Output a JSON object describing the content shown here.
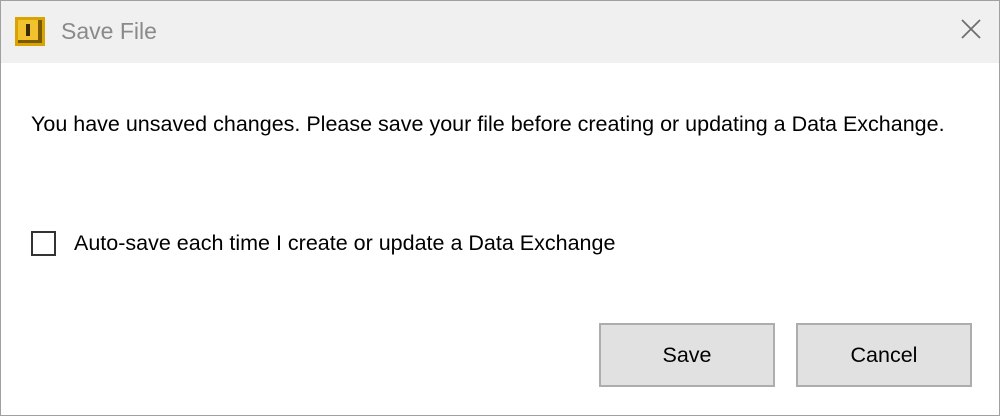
{
  "window": {
    "title": "Save File",
    "app_icon": "autodesk-inventor-icon",
    "close_icon": "close-icon",
    "accent": "#d9a300"
  },
  "dialog": {
    "message": "You have unsaved changes. Please save your file before creating or updating a Data Exchange.",
    "checkbox": {
      "label": "Auto-save each time I create or update a Data Exchange",
      "checked": false
    }
  },
  "buttons": {
    "save_label": "Save",
    "cancel_label": "Cancel"
  }
}
